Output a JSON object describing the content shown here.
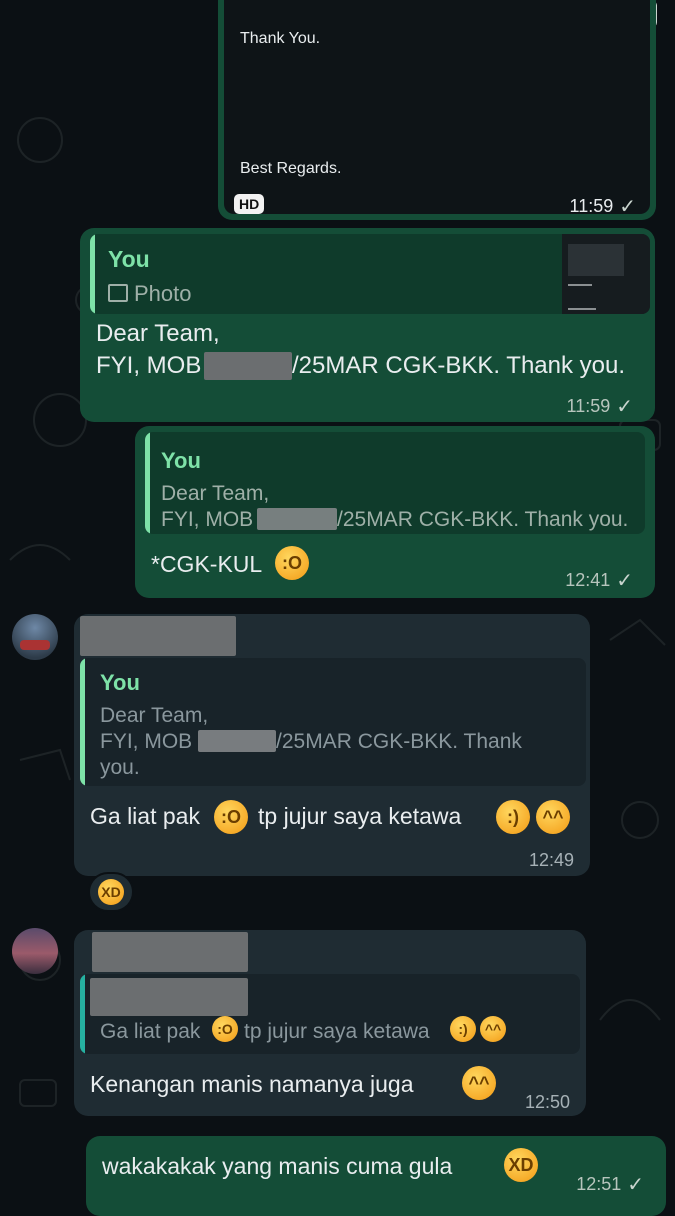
{
  "messages": {
    "m1": {
      "line1": "Thank You.",
      "line2": "Best Regards.",
      "badge": "HD",
      "time": "11:59"
    },
    "m2": {
      "quote_author": "You",
      "quote_type": "Photo",
      "text_line1": "Dear Team,",
      "text_line2_a": "FYI, MOB",
      "text_line2_b": "/25MAR CGK-BKK. Thank you.",
      "time": "11:59"
    },
    "m3": {
      "quote_author": "You",
      "quote_line1": "Dear Team,",
      "quote_line2_a": "FYI, MOB",
      "quote_line2_b": "/25MAR CGK-BKK. Thank you.",
      "text": "*CGK-KUL",
      "time": "12:41"
    },
    "m4": {
      "quote_author": "You",
      "quote_line1": "Dear Team,",
      "quote_line2_a": "FYI, MOB",
      "quote_line2_b": "/25MAR CGK-BKK. Thank",
      "quote_line3": "you.",
      "text_a": "Ga liat pak",
      "text_b": "tp jujur saya ketawa",
      "time": "12:49"
    },
    "m5": {
      "quote_a": "Ga liat pak",
      "quote_b": "tp jujur saya ketawa",
      "text": "Kenangan manis namanya juga",
      "time": "12:50"
    },
    "m6": {
      "text": "wakakakak yang manis cuma gula",
      "time": "12:51"
    }
  },
  "icons": {
    "read": "double-check-icon",
    "photo": "image-icon",
    "reaction": "joy-emoji"
  },
  "colors": {
    "outgoing": "#144d37",
    "incoming": "#1f2c33",
    "quote_name": "#7ee2a8",
    "background": "#0b1014"
  }
}
